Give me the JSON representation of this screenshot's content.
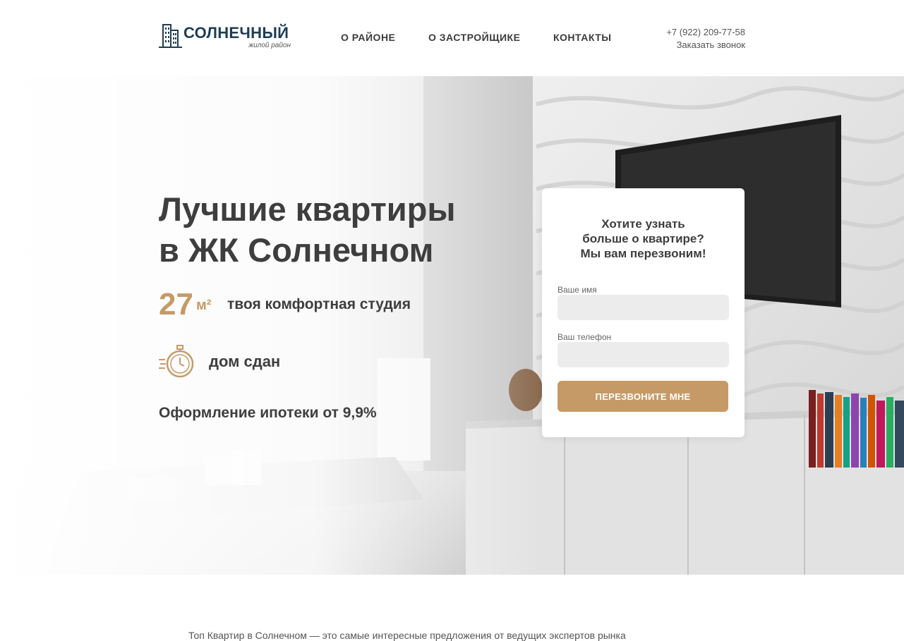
{
  "header": {
    "logo": {
      "title": "СОЛНЕЧНЫЙ",
      "subtitle": "жилой район"
    },
    "nav": [
      {
        "label": "О РАЙОНЕ"
      },
      {
        "label": "О ЗАСТРОЙЩИКЕ"
      },
      {
        "label": "КОНТАКТЫ"
      }
    ],
    "phone": "+7 (922) 209-77-58",
    "callback_link": "Заказать звонок"
  },
  "hero": {
    "headline_line1": "Лучшие квартиры",
    "headline_line2": "в ЖК Солнечном",
    "area_value": "27",
    "area_unit": "м²",
    "area_text": "твоя комфортная студия",
    "status_text": "дом сдан",
    "mortgage_text": "Оформление ипотеки от 9,9%"
  },
  "form": {
    "title_line1": "Хотите узнать",
    "title_line2": "больше о квартире?",
    "title_line3": "Мы вам перезвоним!",
    "name_label": "Ваше имя",
    "name_value": "",
    "phone_label": "Ваш телефон",
    "phone_value": "",
    "submit_label": "ПЕРЕЗВОНИТЕ МНЕ"
  },
  "bottom": {
    "intro_text": "Топ Квартир в Солнечном — это самые интересные предложения от ведущих экспертов рынка"
  },
  "colors": {
    "accent": "#c69a66",
    "text_dark": "#3e3e3e",
    "logo_blue": "#1f3d55",
    "input_bg": "#ececec"
  },
  "icons": [
    "building-logo-icon",
    "stopwatch-icon"
  ]
}
